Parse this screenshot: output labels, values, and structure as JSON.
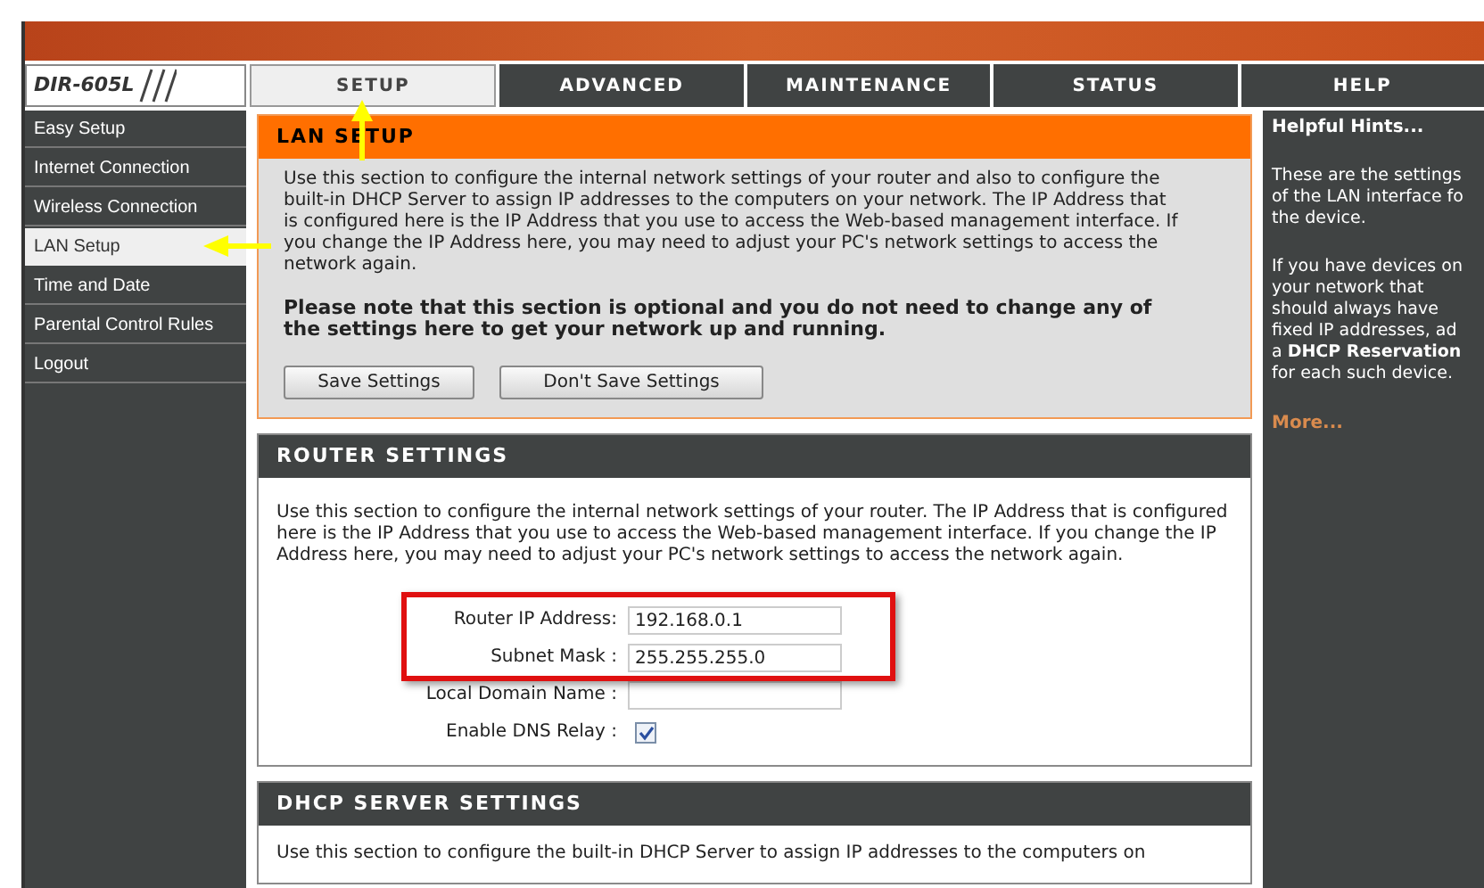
{
  "model": "DIR-605L",
  "tabs": [
    {
      "label": "SETUP",
      "selected": true
    },
    {
      "label": "ADVANCED",
      "selected": false
    },
    {
      "label": "MAINTENANCE",
      "selected": false
    },
    {
      "label": "STATUS",
      "selected": false
    },
    {
      "label": "HELP",
      "selected": false
    }
  ],
  "sidebar": {
    "items": [
      {
        "label": "Easy Setup",
        "selected": false
      },
      {
        "label": "Internet Connection",
        "selected": false
      },
      {
        "label": "Wireless Connection",
        "selected": false
      },
      {
        "label": "LAN Setup",
        "selected": true
      },
      {
        "label": "Time and Date",
        "selected": false
      },
      {
        "label": "Parental Control Rules",
        "selected": false
      },
      {
        "label": "Logout",
        "selected": false
      }
    ]
  },
  "lan_setup": {
    "title": "LAN SETUP",
    "description": "Use this section to configure the internal network settings of your router and also to configure the built-in DHCP Server to assign IP addresses to the computers on your network. The IP Address that is configured here is the IP Address that you use to access the Web-based management interface. If you change the IP Address here, you may need to adjust your PC's network settings to access the network again.",
    "note": "Please note that this section is optional and you do not need to change any of the settings here to get your network up and running.",
    "buttons": [
      "Save Settings",
      "Don't Save Settings"
    ]
  },
  "router_settings": {
    "title": "ROUTER SETTINGS",
    "description": "Use this section to configure the internal network settings of your router. The IP Address that is configured here is the IP Address that you use to access the Web-based management interface. If you change the IP Address here, you may need to adjust your PC's network settings to access the network again.",
    "fields": [
      {
        "kind": "text",
        "label": "Router IP Address:",
        "value": "192.168.0.1"
      },
      {
        "kind": "text",
        "label": "Subnet Mask :",
        "value": "255.255.255.0"
      },
      {
        "kind": "text",
        "label": "Local Domain Name :"
      },
      {
        "kind": "checkbox",
        "label": "Enable DNS Relay :",
        "checked": true
      }
    ]
  },
  "dhcp_server_settings": {
    "title": "DHCP SERVER SETTINGS",
    "description": "Use this section to configure the built-in DHCP Server to assign IP addresses to the computers on"
  },
  "help": {
    "title": "Helpful Hints...",
    "paragraphs": [
      [
        "These are the settings",
        "of the LAN interface fo",
        "the device."
      ],
      [
        "If you have devices on",
        "your network that",
        "should always have",
        "fixed IP addresses, ad",
        "a **DHCP Reservation**",
        "for each such device."
      ]
    ],
    "link": "More..."
  }
}
